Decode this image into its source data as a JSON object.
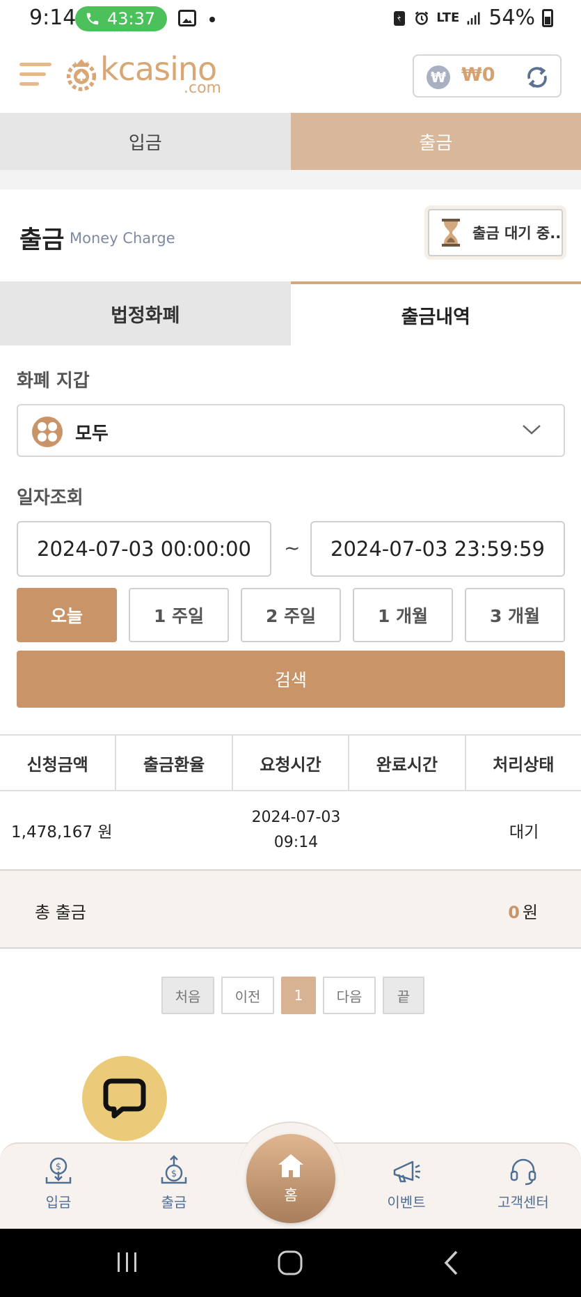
{
  "status_bar": {
    "time": "9:14",
    "call_duration": "43:37",
    "network": "LTE",
    "battery": "54%"
  },
  "header": {
    "logo_text": "kcasino",
    "logo_sub": ".com",
    "wallet_symbol": "₩",
    "wallet_amount": "₩0"
  },
  "top_tabs": {
    "deposit": "입금",
    "withdraw": "출금"
  },
  "section": {
    "title": "출금",
    "subtitle": "Money Charge",
    "pending_label": "출금 대기 중.."
  },
  "sub_tabs": {
    "fiat": "법정화폐",
    "history": "출금내역"
  },
  "wallet_filter": {
    "label": "화폐 지갑",
    "selected": "모두"
  },
  "date_query": {
    "label": "일자조회",
    "start": "2024-07-03 00:00:00",
    "separator": "~",
    "end": "2024-07-03 23:59:59",
    "periods": [
      "오늘",
      "1 주일",
      "2 주일",
      "1 개월",
      "3 개월"
    ],
    "active_period": "오늘",
    "search_label": "검색"
  },
  "table": {
    "headers": [
      "신청금액",
      "출금환율",
      "요청시간",
      "완료시간",
      "처리상태"
    ],
    "rows": [
      {
        "amount": "1,478,167 원",
        "rate": "",
        "request_date": "2024-07-03",
        "request_time": "09:14",
        "completed": "",
        "status": "대기"
      }
    ],
    "total_label": "총 출금",
    "total_value": "0",
    "total_unit": "원"
  },
  "pagination": {
    "first": "처음",
    "prev": "이전",
    "current": "1",
    "next": "다음",
    "last": "끝"
  },
  "bottom_nav": {
    "deposit": "입금",
    "withdraw": "출금",
    "home": "홈",
    "event": "이벤트",
    "support": "고객센터"
  },
  "colors": {
    "accent": "#c99568",
    "tab_active": "#d8b79a",
    "nav_text": "#4f6e94",
    "chat_bubble": "#ebcb79"
  }
}
